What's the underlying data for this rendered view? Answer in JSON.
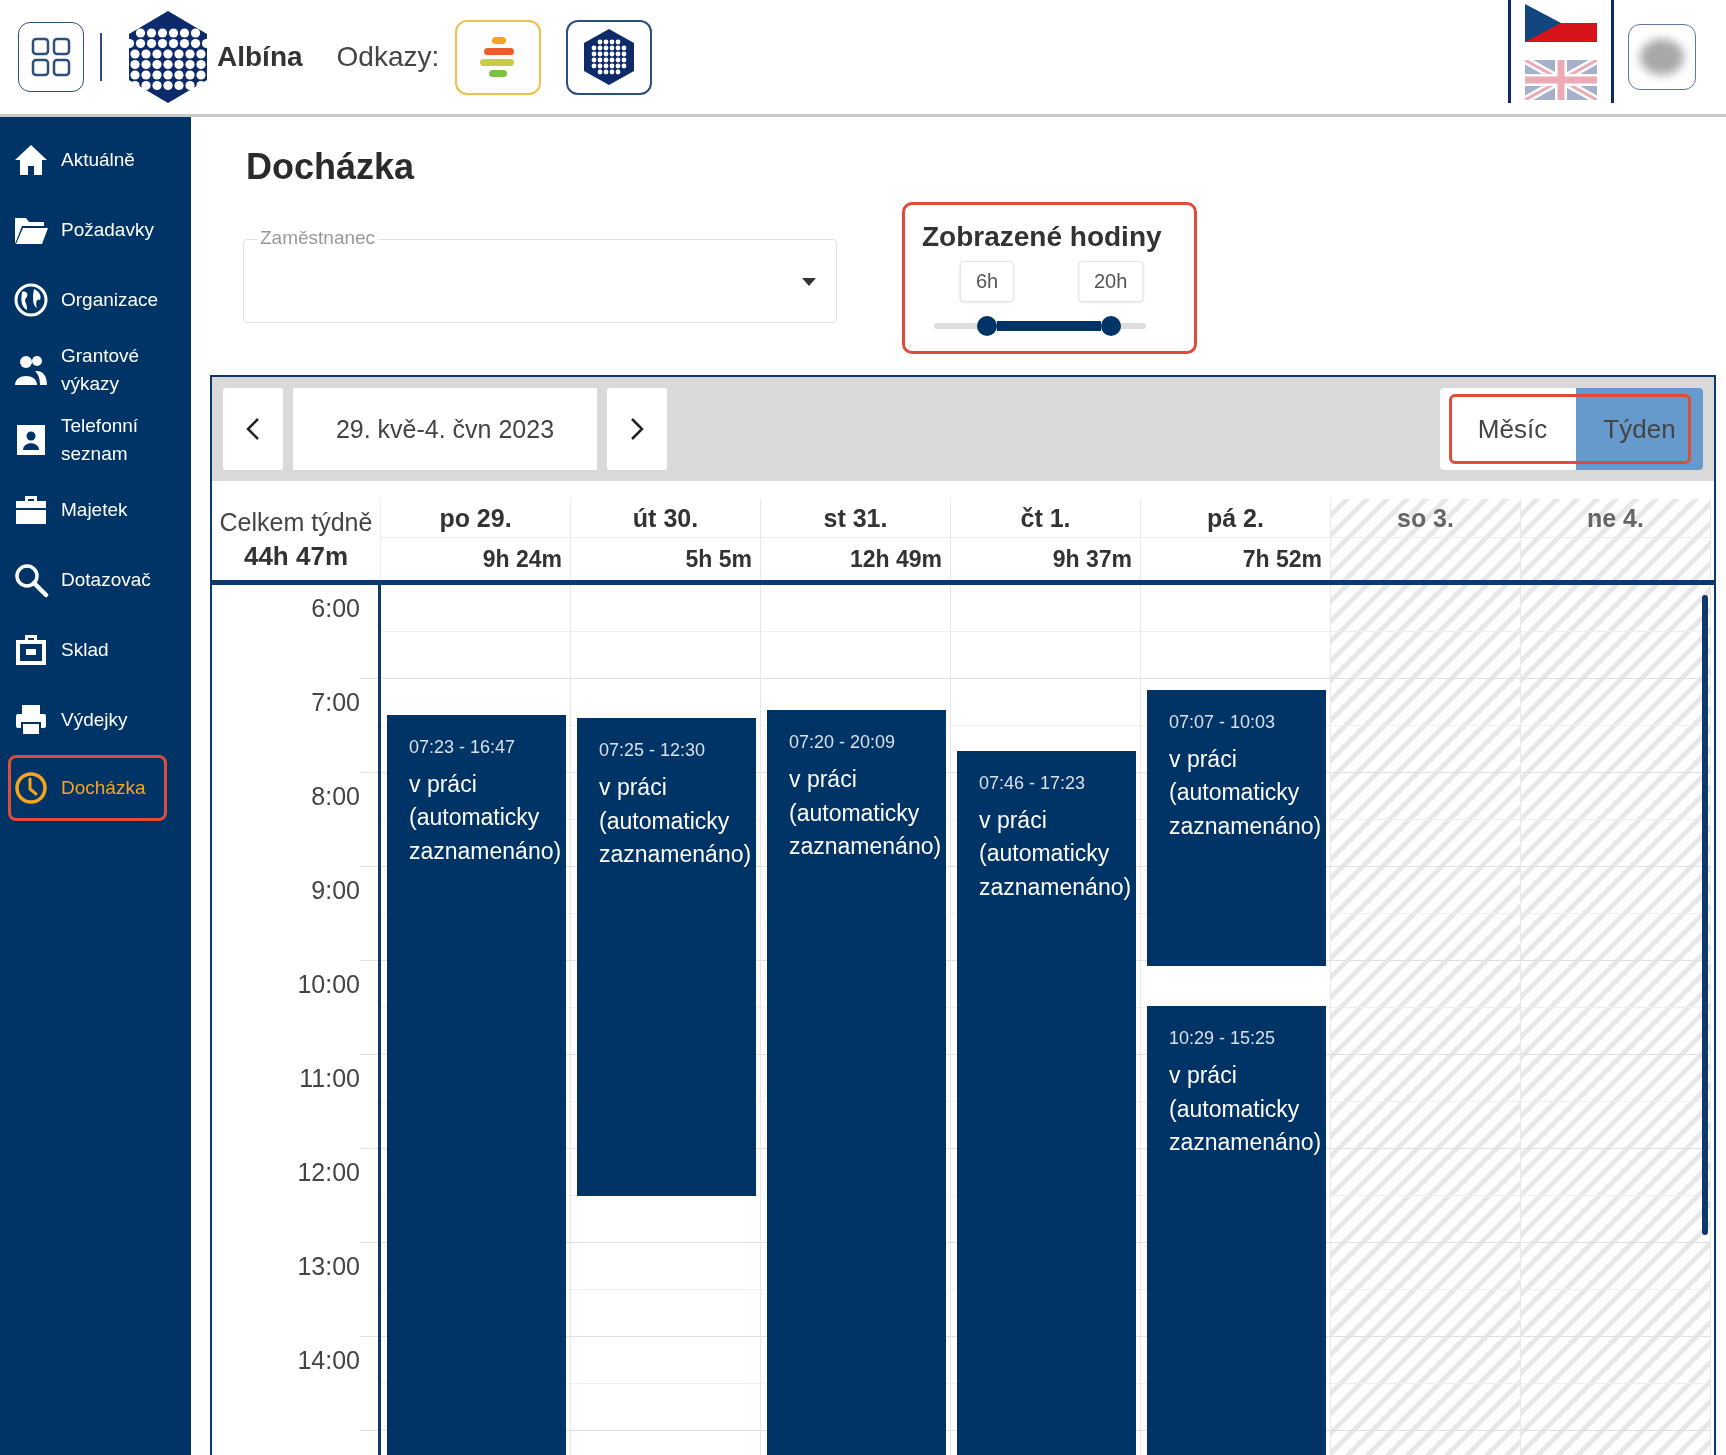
{
  "header": {
    "brand": "Albína",
    "links_label": "Odkazy:"
  },
  "sidebar": {
    "items": [
      {
        "label": "Aktuálně",
        "selected": false
      },
      {
        "label": "Požadavky",
        "selected": false
      },
      {
        "label": "Organizace",
        "selected": false
      },
      {
        "label": "Grantové výkazy",
        "selected": false
      },
      {
        "label": "Telefonní seznam",
        "selected": false
      },
      {
        "label": "Majetek",
        "selected": false
      },
      {
        "label": "Dotazovač",
        "selected": false
      },
      {
        "label": "Sklad",
        "selected": false
      },
      {
        "label": "Výdejky",
        "selected": false
      },
      {
        "label": "Docházka",
        "selected": true
      }
    ]
  },
  "page": {
    "title": "Docházka",
    "employee_field": {
      "label": "Zaměstnanec"
    }
  },
  "hours_filter": {
    "title": "Zobrazené hodiny",
    "thumbs": [
      {
        "label": "6h",
        "level": 0.25
      },
      {
        "label": "20h",
        "level": 0.8333
      }
    ]
  },
  "calendar": {
    "date_range": "29. kvě-4. čvn 2023",
    "views": [
      {
        "label": "Měsíc",
        "selected": false
      },
      {
        "label": "Týden",
        "selected": true
      }
    ],
    "week_total_label": "Celkem týdně",
    "week_total": "44h 47m",
    "hours": [
      "6:00",
      "7:00",
      "8:00",
      "9:00",
      "10:00",
      "11:00",
      "12:00",
      "13:00",
      "14:00"
    ],
    "days": [
      {
        "name": "po 29.",
        "total": "9h 24m",
        "weekend": false,
        "events": [
          {
            "time": "07:23 - 16:47",
            "text": "v práci (automaticky zaznamenáno)"
          }
        ]
      },
      {
        "name": "út 30.",
        "total": "5h 5m",
        "weekend": false,
        "events": [
          {
            "time": "07:25 - 12:30",
            "text": "v práci (automaticky zaznamenáno)"
          }
        ]
      },
      {
        "name": "st 31.",
        "total": "12h 49m",
        "weekend": false,
        "events": [
          {
            "time": "07:20 - 20:09",
            "text": "v práci (automaticky zaznamenáno)"
          }
        ]
      },
      {
        "name": "čt 1.",
        "total": "9h 37m",
        "weekend": false,
        "events": [
          {
            "time": "07:46 - 17:23",
            "text": "v práci (automaticky zaznamenáno)"
          }
        ]
      },
      {
        "name": "pá 2.",
        "total": "7h 52m",
        "weekend": false,
        "events": [
          {
            "time": "07:07 - 10:03",
            "text": "v práci (automaticky zaznamenáno)"
          },
          {
            "time": "10:29 - 15:25",
            "text": "v práci (automaticky zaznamenáno)"
          }
        ]
      },
      {
        "name": "so 3.",
        "weekend": true
      },
      {
        "name": "ne 4.",
        "weekend": true
      }
    ]
  }
}
